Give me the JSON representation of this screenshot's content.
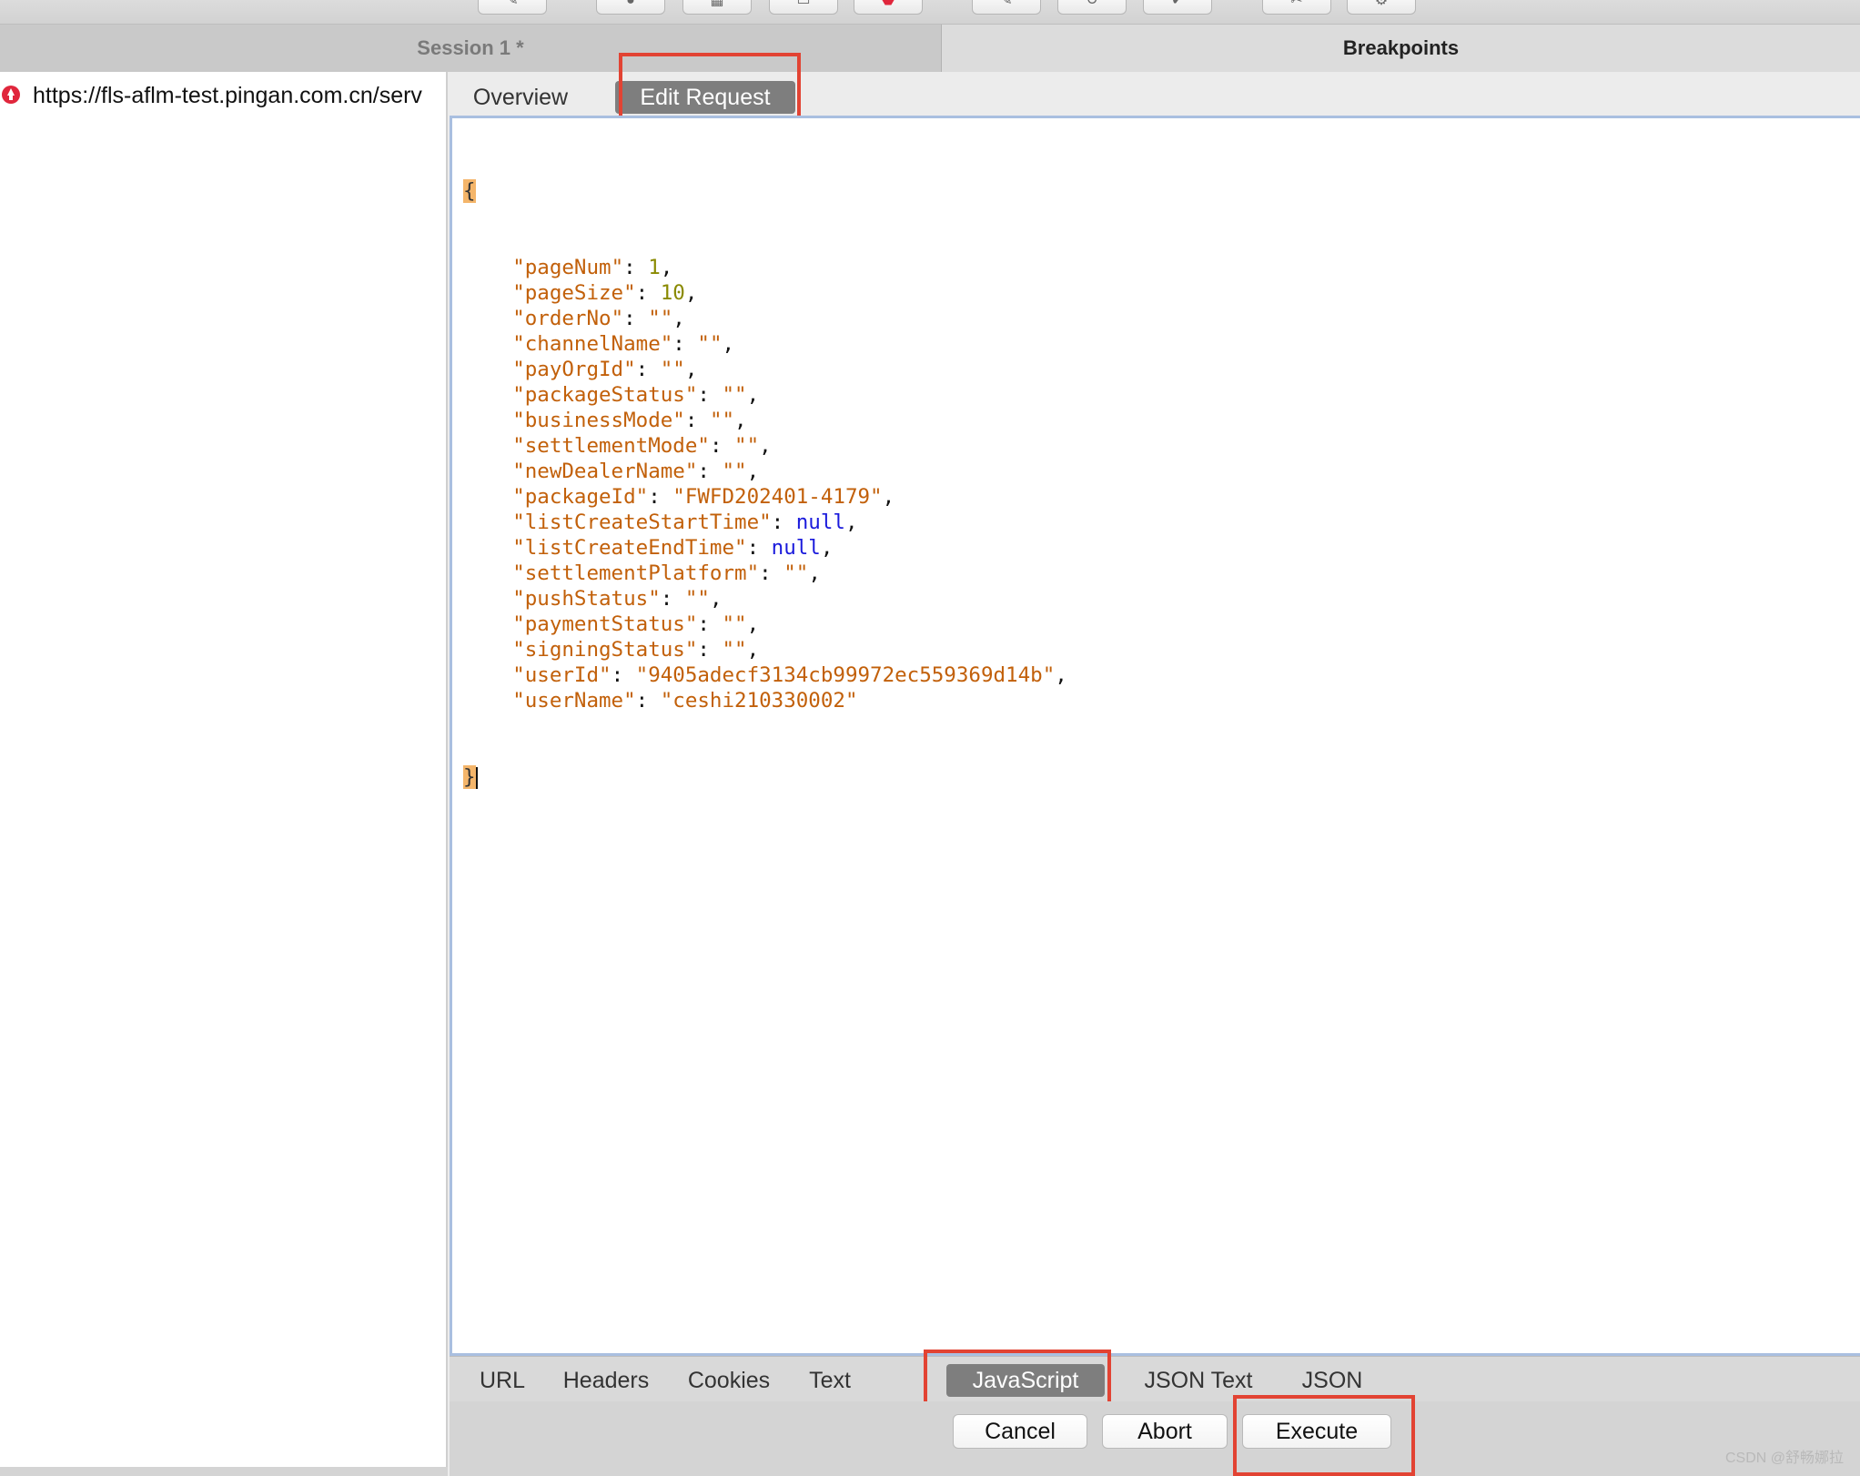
{
  "toolbar": {
    "buttons": [
      {
        "name": "pen-icon",
        "glyph": "✎"
      },
      {
        "name": "record-icon",
        "glyph": "●"
      },
      {
        "name": "throttle-icon",
        "glyph": "▦"
      },
      {
        "name": "lock-icon",
        "glyph": "▭"
      },
      {
        "name": "breakpoint-icon",
        "glyph": "⬣"
      },
      {
        "name": "edit-icon",
        "glyph": "✎"
      },
      {
        "name": "refresh-icon",
        "glyph": "↻"
      },
      {
        "name": "check-icon",
        "glyph": "✔"
      },
      {
        "name": "tools-icon",
        "glyph": "✂"
      },
      {
        "name": "gear-icon",
        "glyph": "⚙"
      }
    ]
  },
  "header": {
    "session_tab": "Session 1 *",
    "breakpoints_tab": "Breakpoints"
  },
  "sidebar": {
    "item_url": "https://fls-aflm-test.pingan.com.cn/serv"
  },
  "request_tabs": {
    "overview": "Overview",
    "edit_request": "Edit Request",
    "active": "Edit Request"
  },
  "editor": {
    "open_brace": "{",
    "close_brace": "}",
    "lines": [
      {
        "key": "pageNum",
        "value": "1",
        "type": "num"
      },
      {
        "key": "pageSize",
        "value": "10",
        "type": "num"
      },
      {
        "key": "orderNo",
        "value": "",
        "type": "str"
      },
      {
        "key": "channelName",
        "value": "",
        "type": "str"
      },
      {
        "key": "payOrgId",
        "value": "",
        "type": "str"
      },
      {
        "key": "packageStatus",
        "value": "",
        "type": "str"
      },
      {
        "key": "businessMode",
        "value": "",
        "type": "str"
      },
      {
        "key": "settlementMode",
        "value": "",
        "type": "str"
      },
      {
        "key": "newDealerName",
        "value": "",
        "type": "str"
      },
      {
        "key": "packageId",
        "value": "FWFD202401-4179",
        "type": "str"
      },
      {
        "key": "listCreateStartTime",
        "value": "null",
        "type": "kw"
      },
      {
        "key": "listCreateEndTime",
        "value": "null",
        "type": "kw"
      },
      {
        "key": "settlementPlatform",
        "value": "",
        "type": "str"
      },
      {
        "key": "pushStatus",
        "value": "",
        "type": "str"
      },
      {
        "key": "paymentStatus",
        "value": "",
        "type": "str"
      },
      {
        "key": "signingStatus",
        "value": "",
        "type": "str"
      },
      {
        "key": "userId",
        "value": "9405adecf3134cb99972ec559369d14b",
        "type": "str"
      },
      {
        "key": "userName",
        "value": "ceshi210330002",
        "type": "str"
      }
    ]
  },
  "view_tabs": {
    "url": "URL",
    "headers": "Headers",
    "cookies": "Cookies",
    "text": "Text",
    "javascript": "JavaScript",
    "json_text": "JSON Text",
    "json": "JSON",
    "active": "JavaScript"
  },
  "actions": {
    "cancel": "Cancel",
    "abort": "Abort",
    "execute": "Execute"
  },
  "watermark": "CSDN @舒畅娜拉",
  "colors": {
    "annotation": "#e24333",
    "active_tab": "#7e7e7e",
    "json_key": "#c2600a",
    "json_number": "#8a8a00",
    "json_null": "#1a1adc",
    "brace_highlight": "#f4b56a",
    "stop_icon": "#e0263c"
  }
}
